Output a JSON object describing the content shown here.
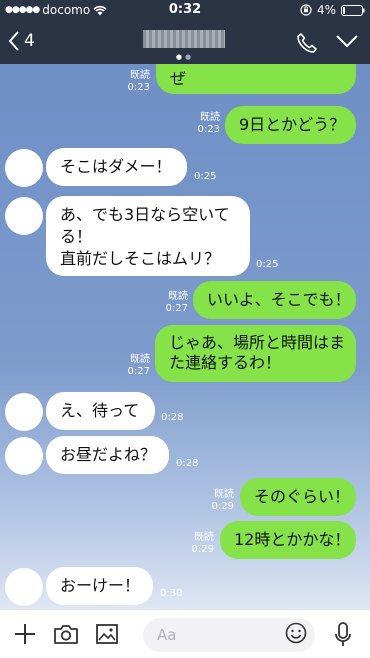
{
  "status": {
    "carrier": "docomo",
    "time": "0:32",
    "battery": "4%"
  },
  "nav": {
    "back_count": "4"
  },
  "messages": [
    {
      "side": "out",
      "text": "ぜ",
      "read": "既読",
      "time": "0:23"
    },
    {
      "side": "out",
      "text": "9日とかどう？",
      "read": "既読",
      "time": "0:23"
    },
    {
      "side": "in",
      "text": "そこはダメー！",
      "time": "0:25"
    },
    {
      "side": "in",
      "lines": [
        "あ、でも3日なら空いて",
        "る！",
        "直前だしそこはムリ？"
      ],
      "time": "0:25"
    },
    {
      "side": "out",
      "text": "いいよ、そこでも！",
      "read": "既読",
      "time": "0:27"
    },
    {
      "side": "out",
      "lines": [
        "じゃあ、場所と時間はま",
        "た連絡するわ！"
      ],
      "read": "既読",
      "time": "0:27"
    },
    {
      "side": "in",
      "text": "え、待って",
      "time": "0:28"
    },
    {
      "side": "in",
      "text": "お昼だよね？",
      "time": "0:28"
    },
    {
      "side": "out",
      "text": "そのぐらい！",
      "read": "既読",
      "time": "0:29"
    },
    {
      "side": "out",
      "text": "12時とかかな！",
      "read": "既読",
      "time": "0:29"
    },
    {
      "side": "in",
      "text": "おーけー！",
      "time": "0:30"
    }
  ],
  "input": {
    "placeholder": "Aa"
  }
}
